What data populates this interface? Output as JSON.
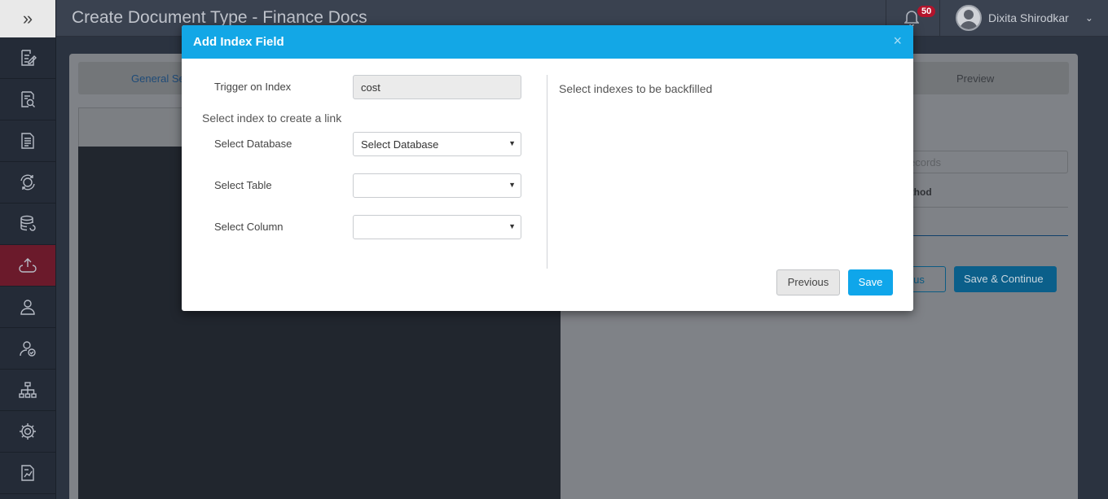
{
  "header": {
    "title": "Create Document Type - Finance Docs",
    "notification_count": "50",
    "user_name": "Dixita Shirodkar"
  },
  "sidebar": {
    "items": [
      {
        "icon": "edit-document-icon"
      },
      {
        "icon": "search-document-icon"
      },
      {
        "icon": "document-icon"
      },
      {
        "icon": "sync-icon"
      },
      {
        "icon": "database-icon"
      },
      {
        "icon": "upload-icon",
        "active": true
      },
      {
        "icon": "user-icon"
      },
      {
        "icon": "user-check-icon"
      },
      {
        "icon": "hierarchy-icon"
      },
      {
        "icon": "gear-icon"
      },
      {
        "icon": "report-icon"
      }
    ]
  },
  "background": {
    "tab_general": "General Se",
    "tab_preview": "Preview",
    "search_placeholder": "ecords",
    "column_header": "ethod",
    "previous_label": "ious",
    "save_continue_label": "Save & Continue"
  },
  "modal": {
    "title": "Add Index Field",
    "close_symbol": "×",
    "trigger_label": "Trigger on Index",
    "trigger_value": "cost",
    "link_section_label": "Select index to create a link",
    "database_label": "Select Database",
    "database_value": "Select Database",
    "table_label": "Select Table",
    "table_value": "",
    "column_label": "Select Column",
    "column_value": "",
    "backfill_label": "Select indexes to be backfilled",
    "previous_button": "Previous",
    "save_button": "Save"
  }
}
